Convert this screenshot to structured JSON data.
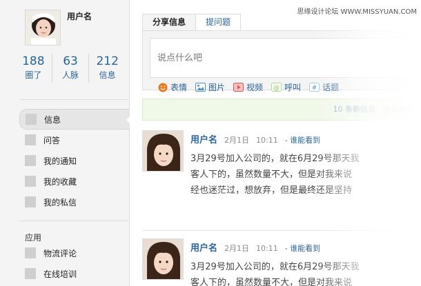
{
  "watermark": "思缘设计论坛 WWW.MISSYUAN.COM",
  "profile": {
    "name": "用户名",
    "stats": [
      {
        "num": "188",
        "label": "圈了"
      },
      {
        "num": "63",
        "label": "人脉"
      },
      {
        "num": "212",
        "label": "信息"
      }
    ]
  },
  "menu": {
    "main": [
      {
        "label": "信息",
        "active": true
      },
      {
        "label": "问答"
      },
      {
        "label": "我的通知"
      },
      {
        "label": "我的收藏"
      },
      {
        "label": "我的私信"
      }
    ],
    "section_title": "应用",
    "apps": [
      {
        "label": "物流评论"
      },
      {
        "label": "在线培训"
      }
    ]
  },
  "share": {
    "tabs": [
      {
        "label": "分享信息",
        "active": true
      },
      {
        "label": "提问题"
      }
    ],
    "placeholder": "说点什么吧",
    "tools": [
      {
        "label": "表情",
        "icon": "smile-icon",
        "color": "#e87a1d"
      },
      {
        "label": "图片",
        "icon": "image-icon",
        "color": "#4a90c8"
      },
      {
        "label": "视频",
        "icon": "video-icon",
        "color": "#d9534f"
      },
      {
        "label": "呼叫",
        "icon": "at-icon",
        "color": "#8bc34a"
      },
      {
        "label": "话题",
        "icon": "hash-icon",
        "color": "#4a90c8"
      }
    ]
  },
  "new_posts": "10 条新信息，点击查看",
  "posts": [
    {
      "author": "用户名",
      "date": "2月1日",
      "time": "10:11",
      "visibility": "- 谁能看到",
      "lines": [
        "3月29号加入公司的，就在6月29号那天我",
        "客人下的，虽然数量不大，但是对我来说",
        "经也迷茫过，想放弃，但是最终还是坚持"
      ]
    },
    {
      "author": "用户名",
      "date": "2月1日",
      "time": "10:11",
      "visibility": "- 谁能看到",
      "lines": [
        "3月29号加入公司的，就在6月29号那天我",
        "客人下的，虽然数量不大，但是对我来说"
      ]
    }
  ]
}
